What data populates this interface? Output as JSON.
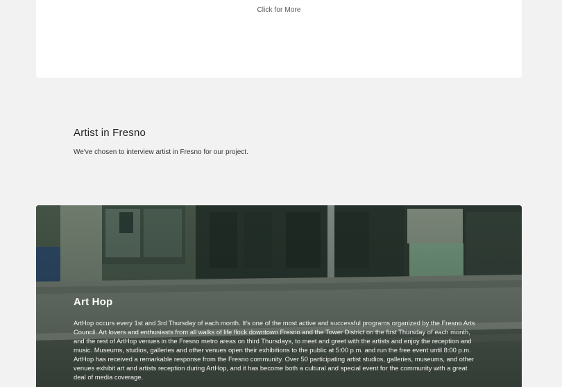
{
  "top_card": {
    "click_more": "Click for More"
  },
  "artist_section": {
    "title": "Artist in Fresno",
    "description": "We've chosen to interview artist in Fresno for our project."
  },
  "arthop_section": {
    "title": "Art Hop",
    "body": "ArtHop occurs every 1st and 3rd Thursday of each month. It's one of the most active and successful programs organized by the Fresno Arts Council. Art lovers and enthusiasts from all walks of life flock downtown Fresno and the Tower District on the first Thursday of each month, and the rest of ArtHop venues in the Fresno metro areas on third Thursdays, to meet and greet with the artists and enjoy the reception and music. Museums, studios, galleries and other venues open their exhibitions to the public at 5:00 p.m. and run the free event until 8:00 p.m. ArtHop has received a remarkable response from the Fresno community. Over 50 participating artist studios, galleries, museums, and other venues exhibit art and artists reception during ArtHop, and it has become both a cultural and special event for the community with a great deal of media coverage."
  },
  "colors": {
    "page_background": "#f2f2f2",
    "card_background": "#ffffff",
    "hero_tint": "#3b4a3f"
  }
}
